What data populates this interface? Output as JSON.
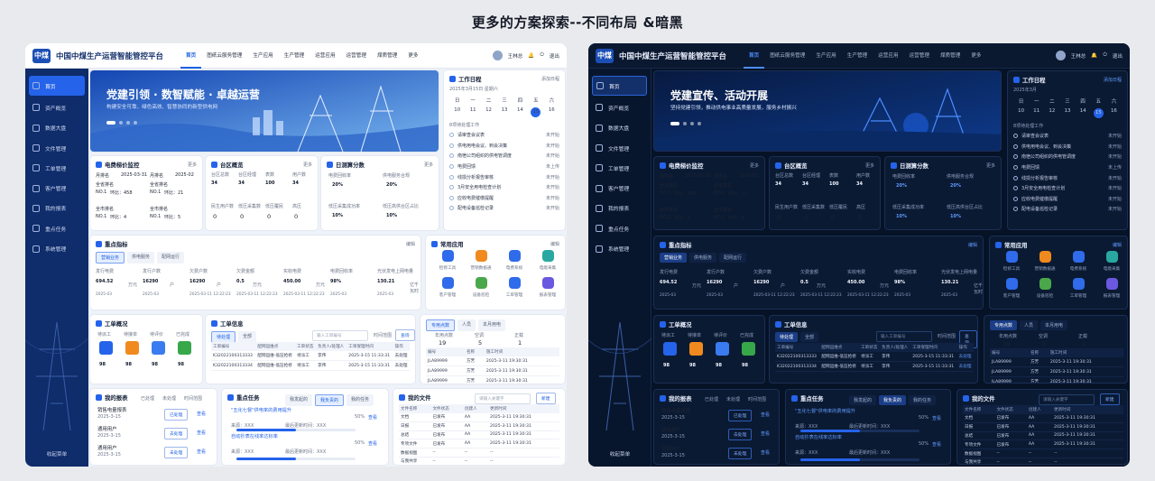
{
  "heading": "更多的方案探索--不同布局 &暗黑",
  "app": {
    "title": "中国中煤生产运营智能管控平台",
    "logo": "中煤",
    "user": "王林总",
    "logout": "退出"
  },
  "nav": [
    "首页",
    "图纸云服务管理",
    "生产应用",
    "生产管理",
    "运营应用",
    "运营管理",
    "煤质管理",
    "更多"
  ],
  "sidebar": [
    "首页",
    "资产概览",
    "数据大盘",
    "文件管理",
    "工单管理",
    "客户管理",
    "我的报表",
    "重点任务",
    "系统管理"
  ],
  "collapse": "收起菜单",
  "banner_light": {
    "title": "党建引领 · 数智赋能 · 卓越运营",
    "sub": "构建安全可靠、绿色高效、智慧协同的新型供电网"
  },
  "banner_dark": {
    "title": "党建宣传、活动开展",
    "sub": "坚持党建引领，推动供电事业高质量发展，服务乡村振兴"
  },
  "schedule": {
    "title": "工作日程",
    "date": "2025年3月15日 星期六",
    "date_dark": "2025年3月",
    "add": "添加日程",
    "weekdays": [
      "日",
      "一",
      "二",
      "三",
      "四",
      "五",
      "六"
    ],
    "days": [
      "9",
      "10",
      "11",
      "12",
      "13",
      "14",
      "15",
      "16"
    ],
    "today": "15",
    "todo_title": "8项待处理工作",
    "tasks": [
      [
        "请审查会议表",
        "未开始"
      ],
      [
        "供电用电会议、到会决策",
        "未开始"
      ],
      [
        "南宿公司组织的供电管调度",
        "未开始"
      ],
      [
        "电费回馈",
        "未上传"
      ],
      [
        "线损分析报告审核",
        "未开始"
      ],
      [
        "3月安全用电检查计划",
        "未开始"
      ],
      [
        "应收电费催缴提醒",
        "未开始"
      ],
      [
        "配电设备巡检记录",
        "未开始"
      ]
    ]
  },
  "electric": {
    "title": "电费梯价监控",
    "more": "更多",
    "m1": "月排名",
    "m1d": "2025-03-31",
    "m2": "月排名",
    "m2d": "2025-02",
    "a1": "全省排名",
    "a2": "全省排名",
    "no1": "NO.1",
    "r1": "环比：458",
    "r2": "环比：21",
    "r3": "环比：4",
    "r4": "环比：5",
    "a3": "全市排名",
    "a4": "全市排名"
  },
  "district": {
    "title": "台区概览",
    "more": "更多",
    "labels": [
      "台区总数",
      "台区经理",
      "表数",
      "用户数"
    ],
    "values": [
      "34",
      "34",
      "100",
      "34"
    ],
    "labels2": [
      "民生用户数",
      "低压采集数",
      "低压覆民",
      "高压"
    ],
    "values2": [
      "0",
      "0",
      "0",
      "0"
    ]
  },
  "daily": {
    "title": "日测算分数",
    "more": "更多",
    "labels": [
      "电费回收率",
      "供电服务合规",
      "低压采集成功率",
      "低压高供台区占比"
    ],
    "values": [
      "20%",
      "20%",
      "10%",
      "10%"
    ]
  },
  "kpi": {
    "title": "重点指标",
    "edit": "编辑",
    "tabs": [
      "营销业务",
      "供电服务",
      "配网运行"
    ],
    "items": [
      [
        "发行电费",
        "694.52",
        "万元",
        "2025-03"
      ],
      [
        "发行户数",
        "16290",
        "户",
        "2025-03"
      ],
      [
        "欠费户数",
        "16290",
        "户",
        "2025-03-11 12:22:23"
      ],
      [
        "欠费金额",
        "0.5",
        "万元",
        "2025-03-11 12:22:23"
      ],
      [
        "实收电费",
        "450.00",
        "万元",
        "2025-03-11 12:22:23"
      ],
      [
        "电费回收率",
        "98%",
        "",
        "2025-03"
      ],
      [
        "光伏发电上网电量",
        "130.21",
        "亿千瓦时",
        "2025-03"
      ]
    ]
  },
  "apps": {
    "title": "常用应用",
    "edit": "编辑",
    "items": [
      "检修工具",
      "营销数据通",
      "电费系统",
      "电能采集",
      "客户管理",
      "设备巡检",
      "工单管理",
      "报表管理"
    ],
    "colors": [
      "#2f6bea",
      "#f08a1e",
      "#2f6bea",
      "#28a8a0",
      "#2f6bea",
      "#4aa84a",
      "#2f6bea",
      "#6b58e0"
    ]
  },
  "wo_overview": {
    "title": "工单概况",
    "labels": [
      "待派工",
      "待接单",
      "待评价",
      "已完成"
    ],
    "values": [
      "98",
      "98",
      "98",
      "98"
    ],
    "colors": [
      "#2563eb",
      "#f08a1e",
      "#3b7bf0",
      "#37a84a"
    ]
  },
  "wo_info": {
    "title": "工单信息",
    "tabs": [
      "待处理",
      "全部"
    ],
    "search": "输入工单编号",
    "time": "时间范围",
    "query": "查询",
    "headers": [
      "工单编号",
      "配网运维点",
      "工单状态",
      "负责人/处理人",
      "工单受理时间",
      "操作"
    ],
    "rows": [
      [
        "K32022100313333",
        "配网运维-低压抢修",
        "待派工",
        "李伟",
        "2025-3-15 11:33:31",
        "去处理"
      ],
      [
        "K32022100313334",
        "配网运维-低压抢修",
        "待派工",
        "李伟",
        "2025-3-15 11:33:31",
        "去处理"
      ]
    ]
  },
  "users": {
    "tabs": [
      "专用点数",
      "人员",
      "本月用电"
    ],
    "labels": [
      "年用点数",
      "空调",
      "正载"
    ],
    "values": [
      "19",
      "5",
      "1"
    ],
    "headers": [
      "编号",
      "名称",
      "施工时间"
    ],
    "rows": [
      [
        "JLA89999",
        "方芳",
        "2025-3-11 19:30:31"
      ],
      [
        "JLA89999",
        "方芳",
        "2025-3-11 19:30:31"
      ],
      [
        "JLA89999",
        "方芳",
        "2025-3-11 19:30:31"
      ],
      [
        "JLA89999",
        "方芳",
        "2025-3-11 19:30:31"
      ]
    ]
  },
  "reports": {
    "title": "我的报表",
    "f1": "已处理",
    "f2": "未处理",
    "f3": "时间范围",
    "items": [
      [
        "销售电量报表",
        "2025-3-15",
        "已处理",
        "查看"
      ],
      [
        "通用用户",
        "2025-3-15",
        "去处理",
        "查看"
      ],
      [
        "通用用户",
        "2025-3-15",
        "未处理",
        "查看"
      ]
    ]
  },
  "tasks": {
    "title": "重点任务",
    "tabs": [
      "我发起的",
      "我负责的",
      "我的任务"
    ],
    "items": [
      [
        "\"五化七督\"供电率的费用提升",
        "50%",
        "来源：XXX",
        "最后更新时间：XXX"
      ],
      [
        "自动抄表在线率达标率",
        "50%",
        "来源：XXX",
        "最后更新时间：XXX"
      ]
    ],
    "view": "查看"
  },
  "files": {
    "title": "我的文件",
    "search": "请输入关键字",
    "new": "新建",
    "headers": [
      "文件名称",
      "文件状态",
      "创建人",
      "更新时间"
    ],
    "rows": [
      [
        "文档",
        "已发布",
        "AA",
        "2025-3-11 19:30:31"
      ],
      [
        "日报",
        "已发布",
        "AA",
        "2025-3-11 19:30:31"
      ],
      [
        "总结",
        "已发布",
        "AA",
        "2025-3-11 19:30:31"
      ],
      [
        "专项文件",
        "已发布",
        "AA",
        "2025-3-11 19:30:31"
      ],
      [
        "数据视图",
        "--",
        "--",
        "--"
      ],
      [
        "与我共享",
        "--",
        "--",
        "--"
      ]
    ]
  }
}
